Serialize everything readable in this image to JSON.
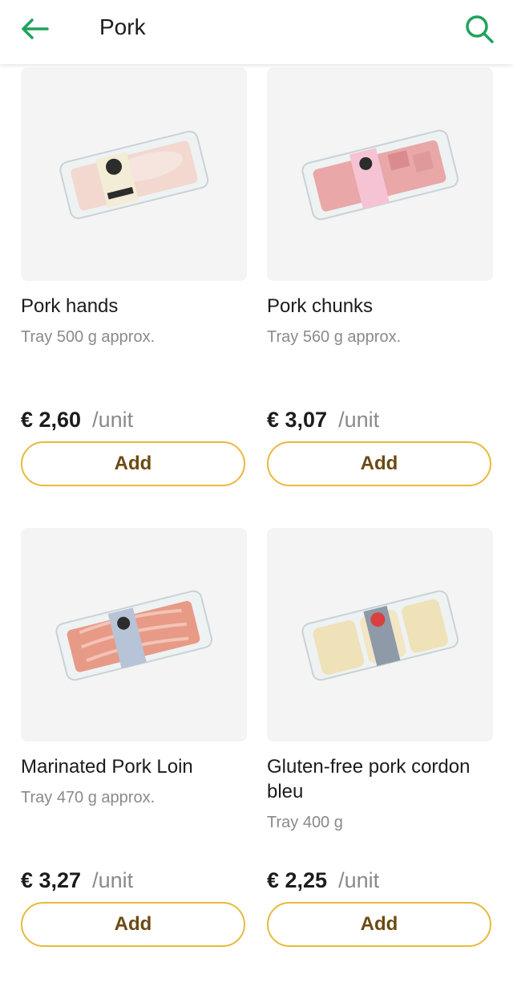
{
  "header": {
    "title": "Pork",
    "back_icon": "arrow-left-icon",
    "search_icon": "search-icon",
    "accent_color": "#1fa35c"
  },
  "button_color": "#e9b93a",
  "products": [
    {
      "name": "Pork hands",
      "size": "Tray 500 g approx.",
      "price": "€ 2,60",
      "unit": "/unit",
      "add_label": "Add"
    },
    {
      "name": "Pork chunks",
      "size": "Tray 560 g approx.",
      "price": "€ 3,07",
      "unit": "/unit",
      "add_label": "Add"
    },
    {
      "name": "Marinated Pork Loin",
      "size": "Tray 470 g approx.",
      "price": "€ 3,27",
      "unit": "/unit",
      "add_label": "Add"
    },
    {
      "name": "Gluten-free pork cordon bleu",
      "size": "Tray 400 g",
      "price": "€ 2,25",
      "unit": "/unit",
      "add_label": "Add"
    }
  ]
}
